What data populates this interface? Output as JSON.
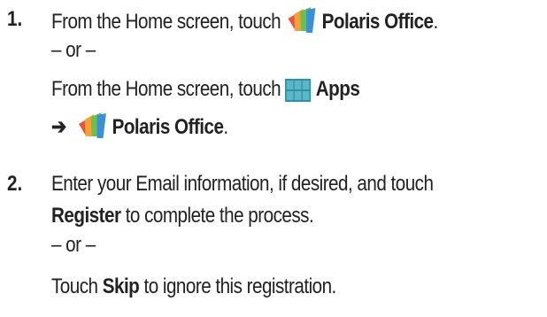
{
  "steps": [
    {
      "number": "1.",
      "line1": {
        "text": "From the Home screen, touch ",
        "bold": "Polaris Office",
        "tail": "."
      },
      "or_text": "– or –",
      "line3": {
        "text": "From the Home screen, touch ",
        "bold": "Apps"
      },
      "line4": {
        "arrow": "➔",
        "bold": "Polaris Office",
        "tail": "."
      }
    },
    {
      "number": "2.",
      "line1": {
        "text": "Enter your Email information, if desired, and touch"
      },
      "line2": {
        "bold": "Register",
        "tail": " to complete the process."
      },
      "or_text": "– or –",
      "line4": {
        "text": "Touch ",
        "bold": "Skip",
        "tail": " to ignore this registration."
      }
    }
  ],
  "icons": {
    "polaris_office": "polaris-office-icon",
    "apps": "apps-grid-icon"
  },
  "colors": {
    "text": "#222222",
    "apps_icon_fill": "#2f8fa8",
    "apps_icon_grid": "#ffffff"
  }
}
